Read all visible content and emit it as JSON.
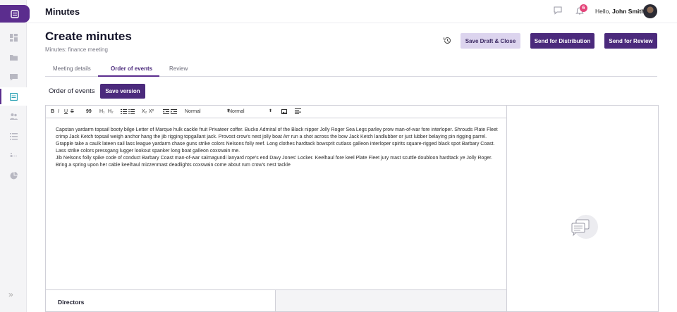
{
  "app": {
    "title": "Minutes"
  },
  "user": {
    "greeting": "Hello,",
    "name": "John Smith",
    "notification_count": "6"
  },
  "page": {
    "title": "Create minutes",
    "subtitle": "Minutes: finance meeting"
  },
  "actions": {
    "save_draft_label": "Save Draft & Close",
    "send_distribution_label": "Send for Distribution",
    "send_review_label": "Send for Review"
  },
  "tabs": [
    {
      "label": "Meeting details"
    },
    {
      "label": "Order of events"
    },
    {
      "label": "Review"
    }
  ],
  "section": {
    "label": "Order of events",
    "save_version_label": "Save version"
  },
  "toolbar": {
    "bold": "B",
    "italic": "I",
    "underline": "U",
    "strike": "S",
    "quote": "99",
    "h1": "H₁",
    "h2": "H₂",
    "sub": "X₂",
    "sup": "X²",
    "font_size_value": "Normal",
    "heading_value": "Normal"
  },
  "editor": {
    "paragraph1": "Capstan yardarm topsail booty bilge Letter of Marque hulk cackle fruit Privateer coffer. Bucko Admiral of the Black nipper Jolly Roger Sea Legs parley prow man-of-war fore interloper. Shrouds Plate Fleet crimp Jack Ketch topsail weigh anchor hang the jib rigging topgallant jack. Provost crow's nest jolly boat Arr run a shot across the bow Jack Ketch landlubber or just lubber belaying pin rigging parrel. Grapple take a caulk lateen sail lass league yardarm chase guns strike colors Nelsons folly reef. Long clothes hardtack bowsprit cutlass galleon interloper spirits square-rigged black spot Barbary Coast. Lass strike colors pressgang lugger lookout spanker long boat galleon coxswain me.",
    "paragraph2": "Jib Nelsons folly spike code of conduct Barbary Coast man-of-war salmagundi lanyard rope's end Davy Jones' Locker. Keelhaul fore keel Plate Fleet jury mast scuttle doubloon hardtack ye Jolly Roger. Bring a spring upon her cable keelhaul mizzenmast deadlights coxswain come about rum crow's nest tackle"
  },
  "bottom": {
    "directors_label": "Directors"
  },
  "colors": {
    "brand": "#4b2a7c",
    "badge": "#e4457a",
    "draft_button": "#dcd4ee"
  }
}
